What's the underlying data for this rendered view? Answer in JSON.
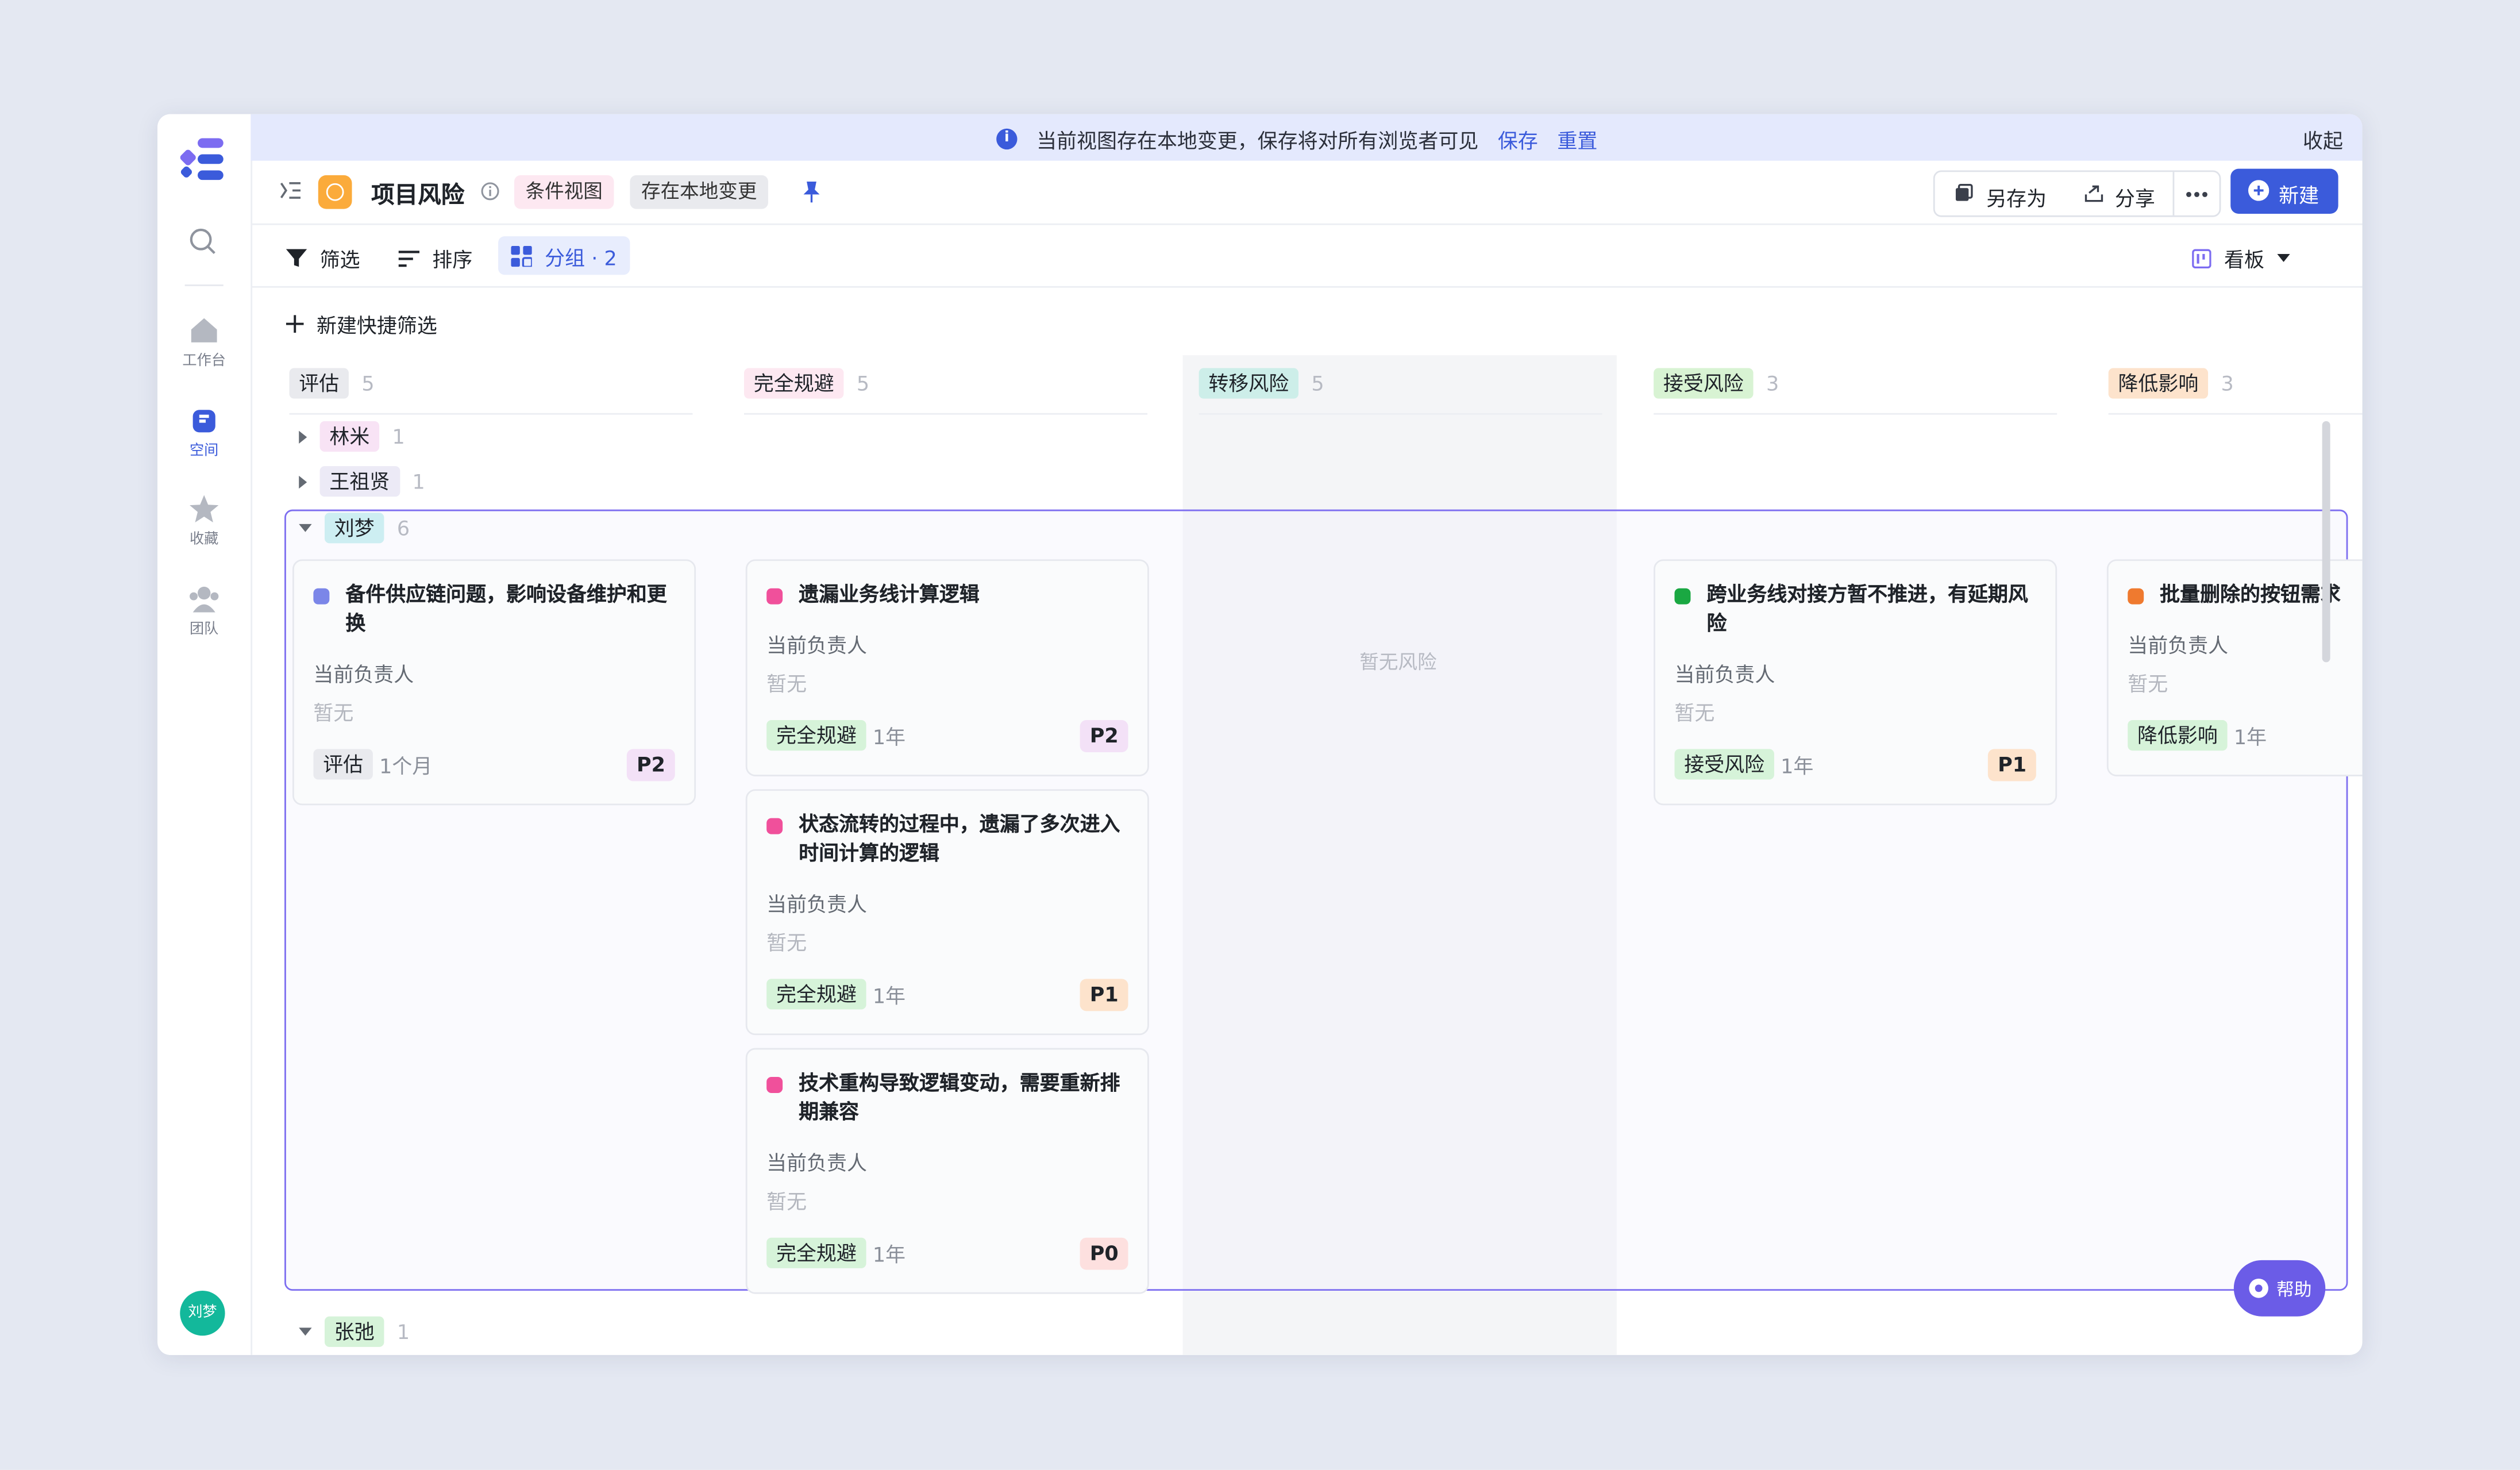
{
  "sidebar": {
    "items": [
      {
        "label": "工作台",
        "icon": "home-icon"
      },
      {
        "label": "空间",
        "icon": "space-icon"
      },
      {
        "label": "收藏",
        "icon": "star-icon"
      },
      {
        "label": "团队",
        "icon": "team-icon"
      }
    ],
    "avatar": "刘梦"
  },
  "banner": {
    "message": "当前视图存在本地变更，保存将对所有浏览者可见",
    "save": "保存",
    "reset": "重置",
    "collapse": "收起"
  },
  "titlebar": {
    "title": "项目风险",
    "view_chip": "条件视图",
    "local_chip": "存在本地变更",
    "save_as": "另存为",
    "share": "分享",
    "new": "新建"
  },
  "toolbar": {
    "filter": "筛选",
    "sort": "排序",
    "group": "分组 · 2",
    "view": "看板"
  },
  "quick_filter": "新建快捷筛选",
  "columns": [
    {
      "label": "评估",
      "count": "5",
      "color": "#e9eaee"
    },
    {
      "label": "完全规避",
      "count": "5",
      "color": "#fde8f1"
    },
    {
      "label": "转移风险",
      "count": "5",
      "color": "#cdeee9"
    },
    {
      "label": "接受风险",
      "count": "3",
      "color": "#d8f3d3"
    },
    {
      "label": "降低影响",
      "count": "3",
      "color": "#fde3cc"
    }
  ],
  "groups": [
    {
      "label": "林米",
      "count": "1",
      "color": "#f8e3f5"
    },
    {
      "label": "王祖贤",
      "count": "1",
      "color": "#eceaf6"
    },
    {
      "label": "刘梦",
      "count": "6",
      "color": "#cdeef2"
    },
    {
      "label": "张弛",
      "count": "1",
      "color": "#d6f3d9"
    }
  ],
  "cards": [
    {
      "title": "备件供应链问题，影响设备维护和更换",
      "owner_label": "当前负责人",
      "owner": "暂无",
      "status": "评估",
      "time": "1个月",
      "priority": "P2",
      "dot": "#7b86e8",
      "status_color": "#e9eaee",
      "priority_color": "#f3e1f7"
    },
    {
      "title": "遗漏业务线计算逻辑",
      "owner_label": "当前负责人",
      "owner": "暂无",
      "status": "完全规避",
      "time": "1年",
      "priority": "P2",
      "dot": "#f0509b",
      "status_color": "#d6f3d9",
      "priority_color": "#f3e1f7"
    },
    {
      "title": "状态流转的过程中，遗漏了多次进入时间计算的逻辑",
      "owner_label": "当前负责人",
      "owner": "暂无",
      "status": "完全规避",
      "time": "1年",
      "priority": "P1",
      "dot": "#f0509b",
      "status_color": "#d6f3d9",
      "priority_color": "#fde3cc"
    },
    {
      "title": "技术重构导致逻辑变动，需要重新排期兼容",
      "owner_label": "当前负责人",
      "owner": "暂无",
      "status": "完全规避",
      "time": "1年",
      "priority": "P0",
      "dot": "#f0509b",
      "status_color": "#d6f3d9",
      "priority_color": "#fde0df"
    },
    {
      "title": "跨业务线对接方暂不推进，有延期风险",
      "owner_label": "当前负责人",
      "owner": "暂无",
      "status": "接受风险",
      "time": "1年",
      "priority": "P1",
      "dot": "#1aa842",
      "status_color": "#d6f3d9",
      "priority_color": "#fde3cc"
    },
    {
      "title": "批量删除的按钮需求",
      "owner_label": "当前负责人",
      "owner": "暂无",
      "status": "降低影响",
      "time": "1年",
      "priority": "",
      "dot": "#ef7a2f",
      "status_color": "#d6f3d9",
      "priority_color": "#fde3cc"
    }
  ],
  "empty_text": "暂无风险",
  "help": "帮助"
}
